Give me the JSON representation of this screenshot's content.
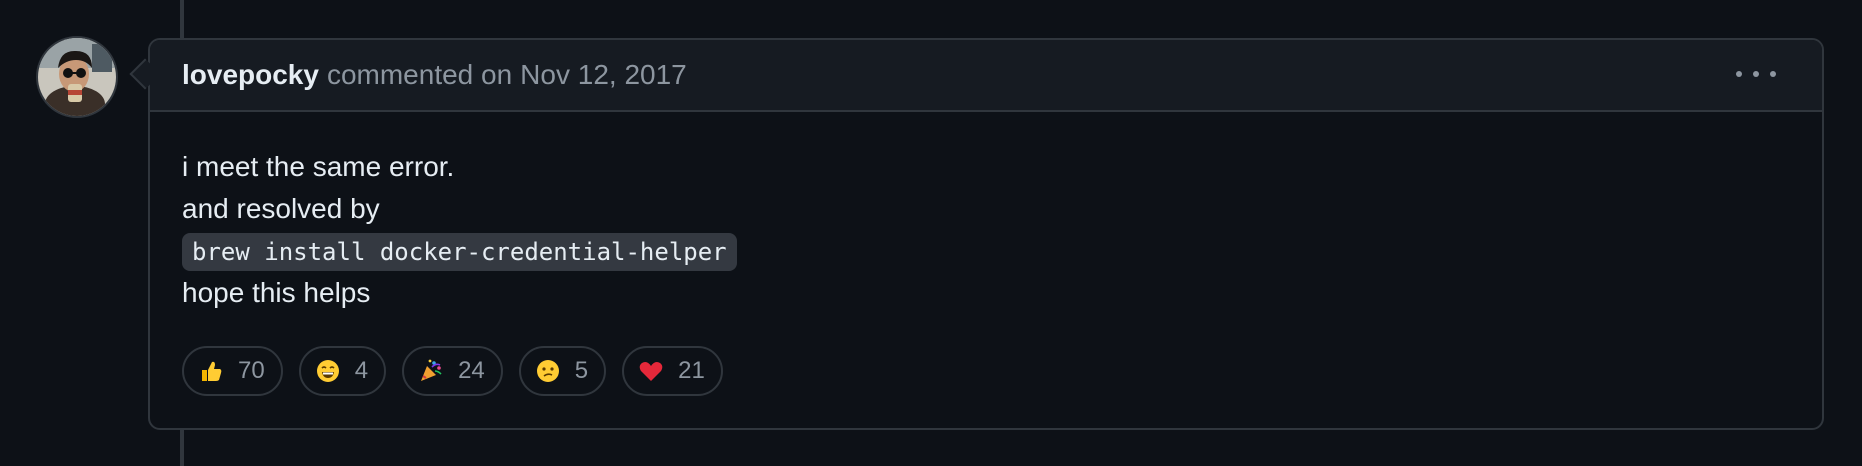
{
  "comment": {
    "author": "lovepocky",
    "action_text": "commented on",
    "date": "Nov 12, 2017",
    "body": {
      "line1": "i meet the same error.",
      "line2": "and resolved by",
      "code": "brew install docker-credential-helper",
      "line4": "hope this helps"
    }
  },
  "reactions": [
    {
      "icon": "thumbs-up-icon",
      "count": "70"
    },
    {
      "icon": "laugh-icon",
      "count": "4"
    },
    {
      "icon": "hooray-icon",
      "count": "24"
    },
    {
      "icon": "confused-icon",
      "count": "5"
    },
    {
      "icon": "heart-icon",
      "count": "21"
    }
  ],
  "colors": {
    "background": "#0d1117",
    "header_bg": "#161b22",
    "border": "#30363d",
    "muted_text": "#8d96a0",
    "text": "#e6edf3",
    "code_bg": "#343941"
  }
}
